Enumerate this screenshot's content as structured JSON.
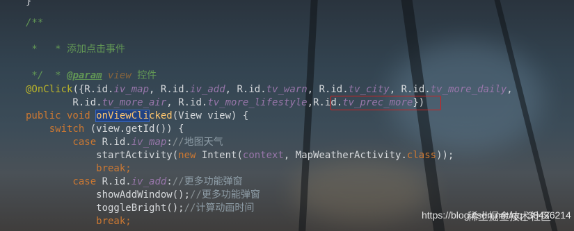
{
  "code": {
    "line0": "}",
    "line1": "/**",
    "line2_prefix": " * ",
    "line2_text": "添加点击事件",
    "line3": " *",
    "line4_prefix": " * ",
    "line4_tag": "@param",
    "line4_param": "view",
    "line4_desc": "控件",
    "line5": " */",
    "line6": [
      {
        "c": "ann",
        "t": "@OnClick"
      },
      {
        "c": "txt",
        "t": "({R.id."
      },
      {
        "c": "fld",
        "t": "iv_map"
      },
      {
        "c": "txt",
        "t": ", R.id."
      },
      {
        "c": "fld",
        "t": "iv_add"
      },
      {
        "c": "txt",
        "t": ", R.id."
      },
      {
        "c": "fld",
        "t": "tv_warn"
      },
      {
        "c": "txt",
        "t": ", R.id."
      },
      {
        "c": "fld",
        "t": "tv_city"
      },
      {
        "c": "txt",
        "t": ", R.id."
      },
      {
        "c": "fld",
        "t": "tv_more_daily"
      },
      {
        "c": "txt",
        "t": ","
      }
    ],
    "line7": [
      {
        "c": "txt",
        "t": "        R.id."
      },
      {
        "c": "fld",
        "t": "tv_more_air"
      },
      {
        "c": "txt",
        "t": ", R.id."
      },
      {
        "c": "fld",
        "t": "tv_more_lifestyle"
      },
      {
        "c": "txt",
        "t": ","
      },
      {
        "c": "txt",
        "t": "R.id."
      },
      {
        "c": "fld",
        "t": "tv_prec_more"
      },
      {
        "c": "txt",
        "t": "})"
      }
    ],
    "line8": [
      {
        "c": "kw",
        "t": "public void "
      },
      {
        "c": "sel",
        "t": "onViewCli"
      },
      {
        "c": "fn",
        "t": "cked"
      },
      {
        "c": "txt",
        "t": "(View view) {"
      }
    ],
    "line9": [
      {
        "c": "kw",
        "t": "    switch "
      },
      {
        "c": "txt",
        "t": "(view.getId()) {"
      }
    ],
    "line10": [
      {
        "c": "kw",
        "t": "        case "
      },
      {
        "c": "txt",
        "t": "R.id."
      },
      {
        "c": "fld",
        "t": "iv_map"
      },
      {
        "c": "txt",
        "t": ":"
      },
      {
        "c": "g",
        "t": "//"
      },
      {
        "c": "cn",
        "t": "地图天气"
      }
    ],
    "line11": [
      {
        "c": "txt",
        "t": "            startActivity("
      },
      {
        "c": "kw",
        "t": "new "
      },
      {
        "c": "txt",
        "t": "Intent("
      },
      {
        "c": "fld2",
        "t": "context"
      },
      {
        "c": "txt",
        "t": ", MapWeatherActivity."
      },
      {
        "c": "kw",
        "t": "class"
      },
      {
        "c": "txt",
        "t": "));"
      }
    ],
    "line12": [
      {
        "c": "kw",
        "t": "            break;"
      }
    ],
    "line13": [
      {
        "c": "kw",
        "t": "        case "
      },
      {
        "c": "txt",
        "t": "R.id."
      },
      {
        "c": "fld",
        "t": "iv_add"
      },
      {
        "c": "txt",
        "t": ":"
      },
      {
        "c": "g",
        "t": "//"
      },
      {
        "c": "cn",
        "t": "更多功能弹窗"
      }
    ],
    "line14": [
      {
        "c": "txt",
        "t": "            showAddWindow();"
      },
      {
        "c": "g",
        "t": "//"
      },
      {
        "c": "cn",
        "t": "更多功能弹窗"
      }
    ],
    "line15": [
      {
        "c": "txt",
        "t": "            toggleBright();"
      },
      {
        "c": "g",
        "t": "//"
      },
      {
        "c": "cn",
        "t": "计算动画时间"
      }
    ],
    "line16": [
      {
        "c": "kw",
        "t": "            break;"
      }
    ]
  },
  "watermark": {
    "url": "https://blog.csdn.net/qq_38436214",
    "logo_text": "稀土掘金技术社区"
  },
  "colors": {
    "keyword": "#cc7832",
    "field": "#9876aa",
    "annotation": "#bbb529",
    "comment": "#629755",
    "highlight_box": "#d02020",
    "selection": "#214283"
  }
}
